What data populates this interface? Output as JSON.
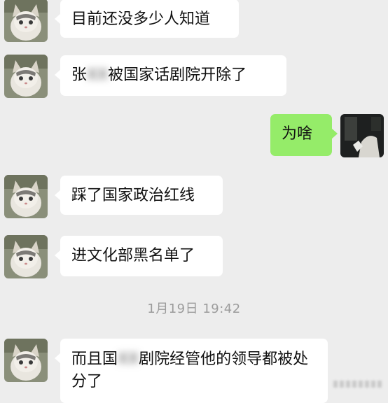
{
  "chat": {
    "messages": [
      {
        "side": "left",
        "text": "目前还没多少人知道"
      },
      {
        "side": "left",
        "prefix": "张",
        "redacted": "XX",
        "suffix": "被国家话剧院开除了"
      },
      {
        "side": "right",
        "text": "为啥"
      },
      {
        "side": "left",
        "text": "踩了国家政治红线"
      },
      {
        "side": "left",
        "text": "进文化部黑名单了"
      },
      {
        "side": "left",
        "prefix": "而且国",
        "redacted": "XX",
        "suffix": "剧院经管他的领导都被处分了"
      }
    ],
    "timestamp": "1月19日 19:42"
  },
  "colors": {
    "background": "#ededed",
    "incoming_bubble": "#ffffff",
    "outgoing_bubble": "#95ec69",
    "timestamp_text": "#9c9c9c"
  },
  "icons": {
    "contact_avatar": "cat-avatar-icon",
    "self_avatar": "photo-avatar-icon"
  }
}
